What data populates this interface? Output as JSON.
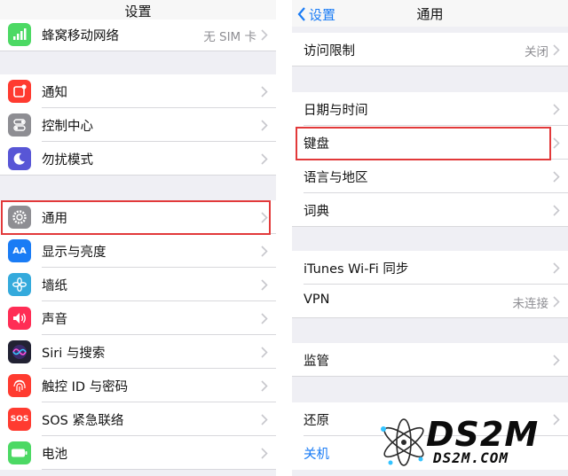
{
  "left": {
    "title": "设置",
    "rows": [
      {
        "label": "蜂窝移动网络",
        "value": "无 SIM 卡",
        "icon": "cellular-icon",
        "color": "#4cd964"
      },
      {
        "label": "通知",
        "icon": "notifications-icon",
        "color": "#ff3b30"
      },
      {
        "label": "控制中心",
        "icon": "control-center-icon",
        "color": "#8e8e93"
      },
      {
        "label": "勿扰模式",
        "icon": "moon-icon",
        "color": "#5856d6"
      },
      {
        "label": "通用",
        "icon": "gear-icon",
        "color": "#8e8e93"
      },
      {
        "label": "显示与亮度",
        "icon": "display-icon",
        "color": "#1a7cf5",
        "glyph": "AA"
      },
      {
        "label": "墙纸",
        "icon": "wallpaper-icon",
        "color": "#34aadc"
      },
      {
        "label": "声音",
        "icon": "speaker-icon",
        "color": "#ff2d55"
      },
      {
        "label": "Siri 与搜索",
        "icon": "siri-icon",
        "color": "#222233"
      },
      {
        "label": "触控 ID 与密码",
        "icon": "fingerprint-icon",
        "color": "#ff3b30"
      },
      {
        "label": "SOS 紧急联络",
        "icon": "sos-icon",
        "color": "#ff3b30",
        "glyph": "SOS"
      },
      {
        "label": "电池",
        "icon": "battery-icon",
        "color": "#4cd964"
      }
    ]
  },
  "right": {
    "back_label": "设置",
    "title": "通用",
    "rows": [
      {
        "label": "访问限制",
        "value": "关闭"
      },
      {
        "label": "日期与时间"
      },
      {
        "label": "键盘"
      },
      {
        "label": "语言与地区"
      },
      {
        "label": "词典"
      },
      {
        "label": "iTunes Wi-Fi 同步"
      },
      {
        "label": "VPN",
        "value": "未连接"
      },
      {
        "label": "监管"
      },
      {
        "label": "还原"
      },
      {
        "label": "关机"
      }
    ]
  },
  "watermark": {
    "logo": "DS2M",
    "domain": "DS2M.COM"
  },
  "colors": {
    "accent": "#1a7cf5",
    "highlight": "#e2393a",
    "group_bg": "#efeff4"
  }
}
